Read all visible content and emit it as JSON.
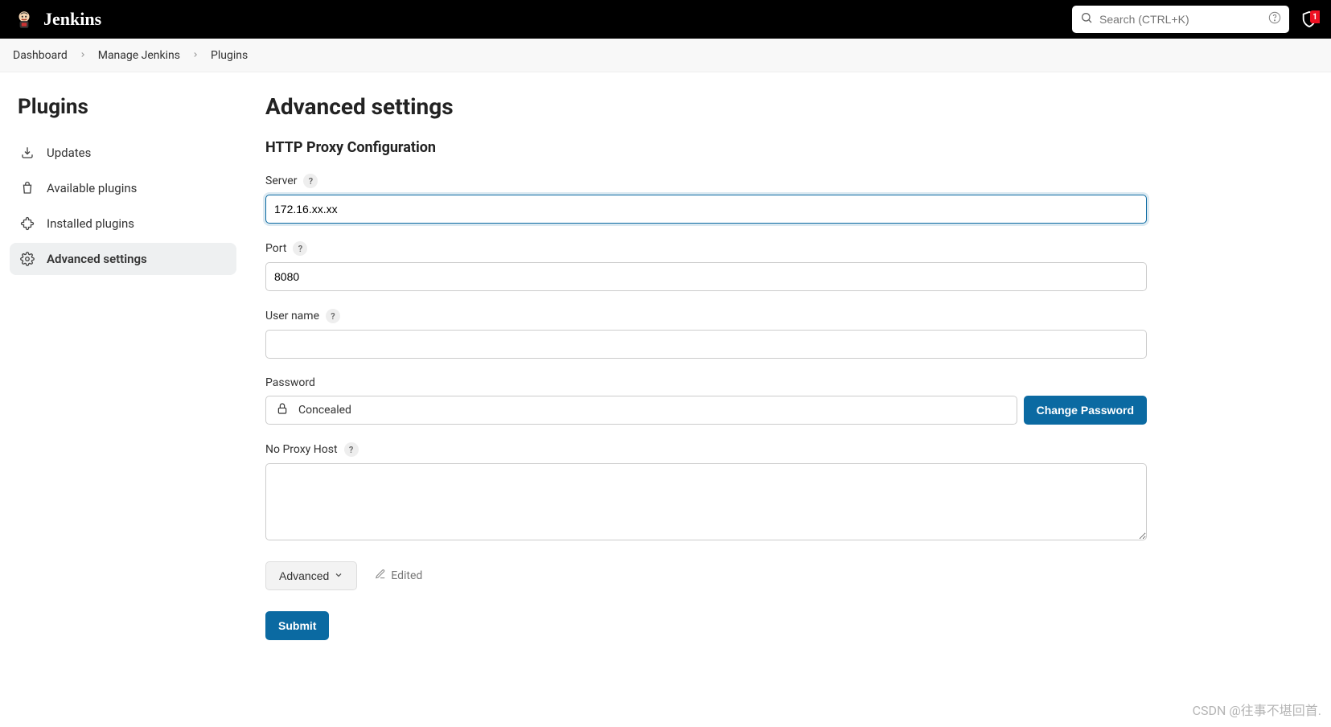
{
  "header": {
    "brand": "Jenkins",
    "search_placeholder": "Search (CTRL+K)",
    "notification_count": "1"
  },
  "breadcrumbs": {
    "items": [
      "Dashboard",
      "Manage Jenkins",
      "Plugins"
    ]
  },
  "sidebar": {
    "title": "Plugins",
    "items": [
      {
        "label": "Updates"
      },
      {
        "label": "Available plugins"
      },
      {
        "label": "Installed plugins"
      },
      {
        "label": "Advanced settings"
      }
    ]
  },
  "page": {
    "title": "Advanced settings",
    "section_title": "HTTP Proxy Configuration"
  },
  "form": {
    "server_label": "Server",
    "server_value": "172.16.xx.xx",
    "port_label": "Port",
    "port_value": "8080",
    "username_label": "User name",
    "username_value": "",
    "password_label": "Password",
    "concealed_text": "Concealed",
    "change_password_label": "Change Password",
    "noproxy_label": "No Proxy Host",
    "noproxy_value": "",
    "advanced_label": "Advanced",
    "edited_label": "Edited",
    "submit_label": "Submit"
  },
  "watermark": "CSDN @往事不堪回首."
}
